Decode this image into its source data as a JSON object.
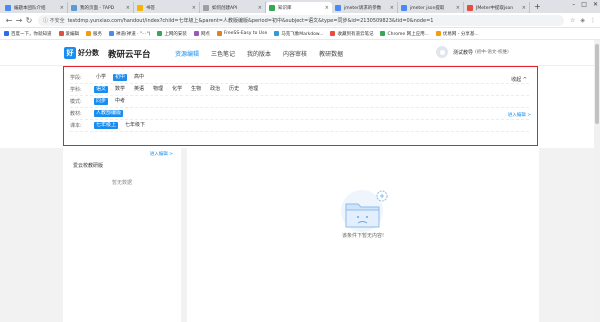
{
  "browser": {
    "tabs": [
      {
        "title": "编题本团队介绍",
        "color": "#4a8af4",
        "active": false
      },
      {
        "title": "我的页面 - TAPD",
        "color": "#5b9bd5",
        "active": false
      },
      {
        "title": "书签",
        "color": "#f4b400",
        "active": false
      },
      {
        "title": "如何创建API",
        "color": "#9aa0a6",
        "active": false
      },
      {
        "title": "知识库",
        "color": "#34a853",
        "active": true
      },
      {
        "title": "jmeter请求的参数",
        "color": "#4a8af4",
        "active": false
      },
      {
        "title": "jmeter json提取",
        "color": "#4a8af4",
        "active": false
      },
      {
        "title": "JMeter中提取json",
        "color": "#e74c3c",
        "active": false
      }
    ],
    "new_tab": "+",
    "window_controls": {
      "minimize": "–",
      "maximize": "□",
      "close": "✕"
    },
    "nav": {
      "back": "←",
      "forward": "→",
      "reload": "↻"
    },
    "security_label": "ⓘ 不安全",
    "url": "testdmp.yunxiao.com/handout/index?child=七年级上&parent=人教版编版&period=初中&subject=语文&type=同步&id=2130509823&tid=0&node=1",
    "bookmarks": [
      {
        "label": "百度一下，你就知道",
        "color": "#2e6be6"
      },
      {
        "label": "爱编辑",
        "color": "#e74c3c"
      },
      {
        "label": "服务",
        "color": "#f39c12"
      },
      {
        "label": "禅道(禅道 · \"- ·\")",
        "color": "#4a8af4"
      },
      {
        "label": "上网的安装",
        "color": "#34a853"
      },
      {
        "label": "网点",
        "color": "#9b59b6"
      },
      {
        "label": "FreeSS-Easy to Use",
        "color": "#e67e22"
      },
      {
        "label": "马克飞象Markdow...",
        "color": "#3498db"
      },
      {
        "label": "收藏到有道云笔记",
        "color": "#e74c3c"
      },
      {
        "label": "Chrome 网上应用...",
        "color": "#34a853"
      },
      {
        "label": "优易网 - 分享基...",
        "color": "#f39c12"
      }
    ]
  },
  "app": {
    "logo_mark": "好",
    "logo_text": "好分数",
    "platform": "教研云平台",
    "nav": [
      "资源编辑",
      "三色笔记",
      "我的版本",
      "内容审核",
      "教研数据"
    ],
    "active_nav": 0,
    "user_name": "测试教导",
    "user_sub": "(初中-语文-校维)"
  },
  "filter": {
    "collapse_label": "收起 ^",
    "enter_edit": "进入编辑 >",
    "rows": [
      {
        "label": "学段:",
        "options": [
          "小学",
          "初中",
          "高中"
        ],
        "selected": 1
      },
      {
        "label": "学科:",
        "options": [
          "语文",
          "数学",
          "英语",
          "物理",
          "化学",
          "生物",
          "政治",
          "历史",
          "地理"
        ],
        "selected": 0
      },
      {
        "label": "模式:",
        "options": [
          "同步",
          "中考"
        ],
        "selected": 0
      },
      {
        "label": "教材:",
        "options": [
          "人教部编版"
        ],
        "selected": 0
      },
      {
        "label": "课本:",
        "options": [
          "七年级上",
          "七年级下"
        ],
        "selected": 0
      }
    ]
  },
  "left_panel": {
    "link": "进入编辑 >",
    "title": "爱云校教研版",
    "empty": "暂无数据"
  },
  "main": {
    "empty_text": "该条件下暂无内容!"
  }
}
